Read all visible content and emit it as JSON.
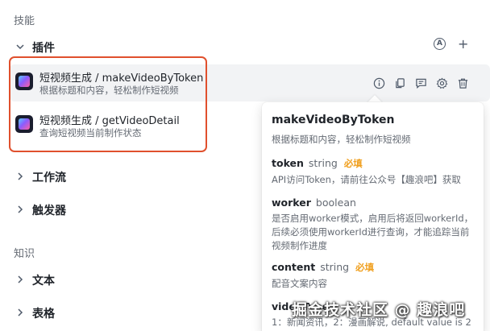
{
  "sections": {
    "skills_label": "技能",
    "knowledge_label": "知识"
  },
  "plugins_group": {
    "title": "插件",
    "auto_icon_letter": "A",
    "add_symbol": "+"
  },
  "plugins": [
    {
      "title": "短视频生成 / makeVideoByToken",
      "desc": "根据标题和内容，轻松制作短视频"
    },
    {
      "title": "短视频生成 / getVideoDetail",
      "desc": "查询短视频当前制作状态"
    }
  ],
  "groups": {
    "workflow": "工作流",
    "trigger": "触发器",
    "text": "文本",
    "table": "表格"
  },
  "tooltip": {
    "title": "makeVideoByToken",
    "desc": "根据标题和内容，轻松制作短视频",
    "params": [
      {
        "name": "token",
        "type": "string",
        "required": "必填",
        "desc": "API访问Token，请前往公众号【趣浪吧】获取"
      },
      {
        "name": "worker",
        "type": "boolean",
        "required": "",
        "desc": "是否启用worker模式，启用后将返回workerId，后续必须使用workerId进行查询，才能追踪当前视频制作进度"
      },
      {
        "name": "content",
        "type": "string",
        "required": "必填",
        "desc": "配音文案内容"
      },
      {
        "name": "videoType",
        "type": "",
        "required": "",
        "desc": "1：新闻资讯，2：漫画解说, default value is 2"
      }
    ]
  },
  "watermark": "掘金技术社区 @ 趣浪吧",
  "colors": {
    "highlight_border": "#e0502d",
    "required": "#f0a020",
    "muted_text": "#646a73"
  }
}
